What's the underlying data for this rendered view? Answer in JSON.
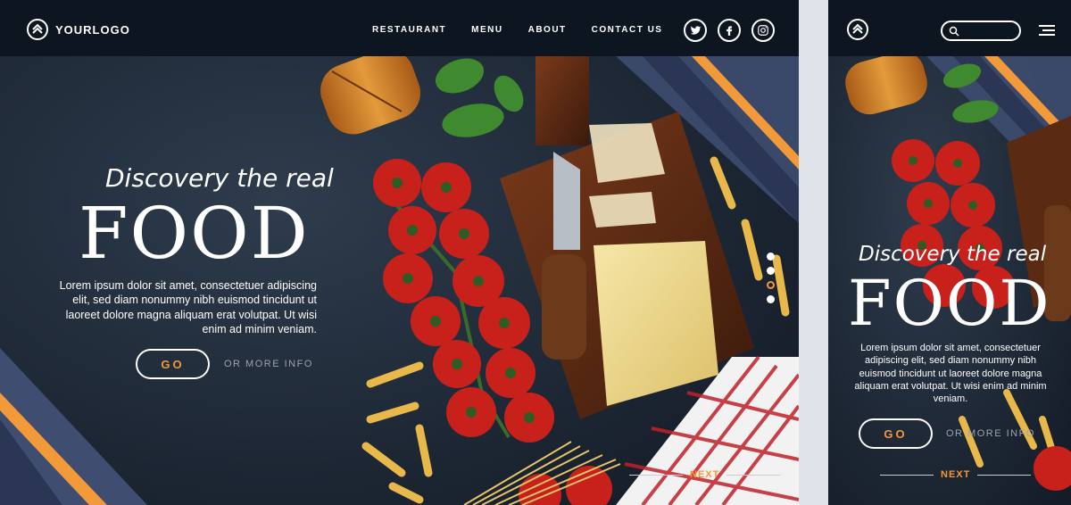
{
  "brand": {
    "logo_text": "YOURLOGO"
  },
  "nav": {
    "items": [
      "RESTAURANT",
      "MENU",
      "ABOUT",
      "CONTACT US"
    ]
  },
  "socials": [
    "twitter-icon",
    "facebook-icon",
    "instagram-icon"
  ],
  "hero": {
    "tagline": "Discovery the real",
    "headline": "FOOD",
    "body_desktop": "Lorem ipsum dolor sit amet, consectetuer adipiscing elit, sed diam nonummy nibh euismod tincidunt ut laoreet dolore magna aliquam erat volutpat. Ut wisi enim ad minim veniam.",
    "body_mobile": "Lorem ipsum dolor sit amet, consectetuer adipiscing elit, sed diam nonummy nibh euismod tincidunt ut laoreet dolore magna aliquam erat volutpat. Ut wisi enim ad minim veniam.",
    "go_label": "GO",
    "more_label": "OR MORE INFO",
    "next_label": "NEXT"
  },
  "slider": {
    "count": 4,
    "active": 3
  },
  "colors": {
    "accent": "#f29a3a",
    "navbar": "#0d1520",
    "stripe": "#3a4a6a"
  }
}
